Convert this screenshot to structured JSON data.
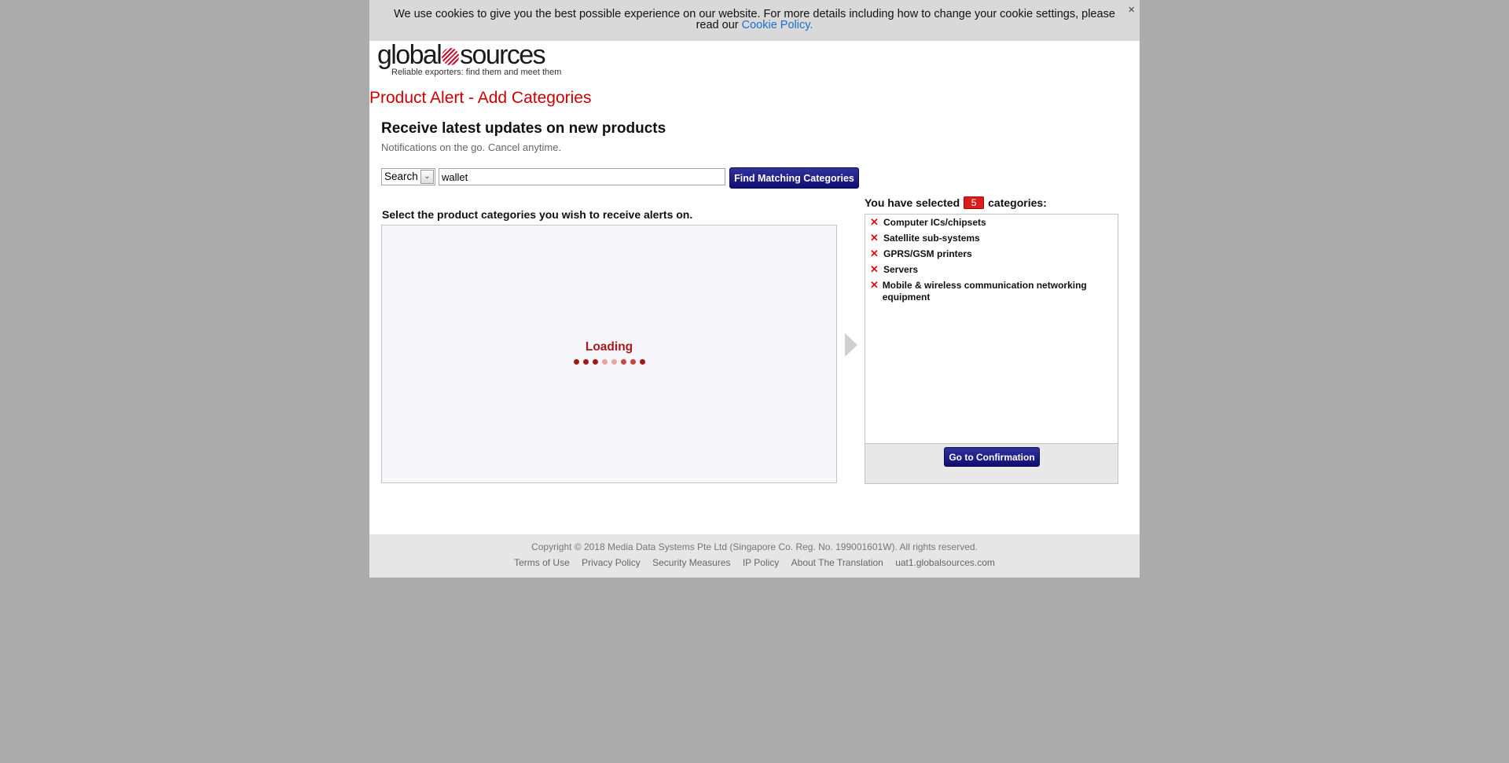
{
  "cookie": {
    "text": "We use cookies to give you the best possible experience on our website. For more details including how to change your cookie settings, please read our",
    "link": "Cookie Policy.",
    "close": "×"
  },
  "logo": {
    "left": "global",
    "right": "sources",
    "tagline": "Reliable exporters: find them and meet them"
  },
  "page_title": "Product Alert - Add Categories",
  "headline": "Receive latest updates on new products",
  "subline": "Notifications on the go. Cancel anytime.",
  "search": {
    "select_value": "Search",
    "input_value": "wallet",
    "button_label": "Find Matching Categories"
  },
  "categories_panel": {
    "label": "Select the product categories you wish to receive alerts on.",
    "loading_text": "Loading"
  },
  "selected": {
    "prefix": "You have selected",
    "count": "5",
    "suffix": "categories:",
    "items": [
      "Computer ICs/chipsets",
      "Satellite sub-systems",
      "GPRS/GSM printers",
      "Servers",
      "Mobile & wireless communication networking equipment"
    ],
    "confirm_label": "Go to Confirmation"
  },
  "footer": {
    "copyright": "Copyright © 2018 Media Data Systems Pte Ltd (Singapore Co. Reg. No. 199001601W). All rights reserved.",
    "links": [
      "Terms of Use",
      "Privacy Policy",
      "Security Measures",
      "IP Policy",
      "About The Translation",
      "uat1.globalsources.com"
    ]
  },
  "icons": {
    "remove": "close-x-icon",
    "arrow": "arrow-right-icon",
    "logo_mark": "globe-stripes-icon"
  },
  "colors": {
    "title_red": "#cc0000",
    "button_blue": "#1a1a80",
    "badge_red": "#d71f1f",
    "loading_red": "#a61a1a"
  }
}
